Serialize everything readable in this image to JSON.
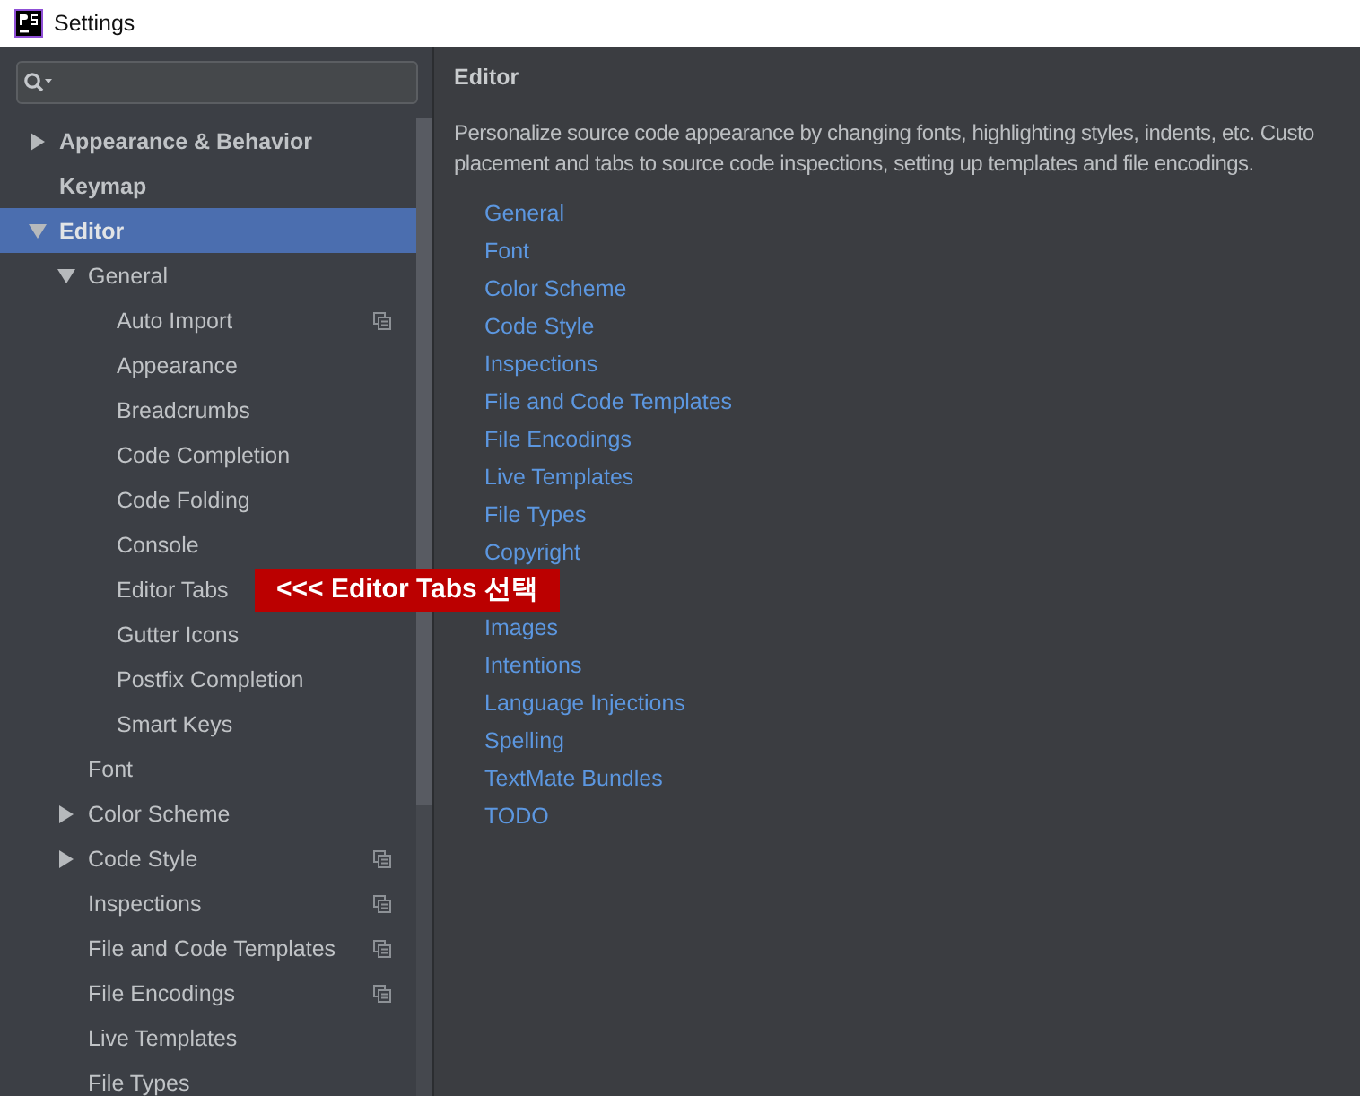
{
  "window": {
    "title": "Settings"
  },
  "tree": [
    {
      "label": "Appearance & Behavior",
      "selected": false,
      "expanded": false,
      "scoped": false
    },
    {
      "label": "Keymap",
      "selected": false,
      "scoped": false
    },
    {
      "label": "Editor",
      "selected": true,
      "expanded": true,
      "scoped": false,
      "children": [
        {
          "label": "General",
          "selected": false,
          "expanded": true,
          "scoped": false,
          "children": [
            {
              "label": "Auto Import",
              "selected": false,
              "scoped": true
            },
            {
              "label": "Appearance",
              "selected": false,
              "scoped": false
            },
            {
              "label": "Breadcrumbs",
              "selected": false,
              "scoped": false
            },
            {
              "label": "Code Completion",
              "selected": false,
              "scoped": false
            },
            {
              "label": "Code Folding",
              "selected": false,
              "scoped": false
            },
            {
              "label": "Console",
              "selected": false,
              "scoped": false
            },
            {
              "label": "Editor Tabs",
              "selected": false,
              "scoped": false
            },
            {
              "label": "Gutter Icons",
              "selected": false,
              "scoped": false
            },
            {
              "label": "Postfix Completion",
              "selected": false,
              "scoped": false
            },
            {
              "label": "Smart Keys",
              "selected": false,
              "scoped": false
            }
          ]
        },
        {
          "label": "Font",
          "selected": false,
          "scoped": false
        },
        {
          "label": "Color Scheme",
          "selected": false,
          "expanded": false,
          "scoped": false
        },
        {
          "label": "Code Style",
          "selected": false,
          "expanded": false,
          "scoped": true
        },
        {
          "label": "Inspections",
          "selected": false,
          "scoped": true
        },
        {
          "label": "File and Code Templates",
          "selected": false,
          "scoped": true
        },
        {
          "label": "File Encodings",
          "selected": false,
          "scoped": true
        },
        {
          "label": "Live Templates",
          "selected": false,
          "scoped": false
        },
        {
          "label": "File Types",
          "selected": false,
          "scoped": false
        }
      ]
    }
  ],
  "content": {
    "title": "Editor",
    "description_lines": [
      "Personalize source code appearance by changing fonts, highlighting styles, indents, etc. Custo",
      "placement and tabs to source code inspections, setting up templates and file encodings."
    ],
    "links": [
      "General",
      "Font",
      "Color Scheme",
      "Code Style",
      "Inspections",
      "File and Code Templates",
      "File Encodings",
      "Live Templates",
      "File Types",
      "Copyright"
    ],
    "more_links": [
      "Images",
      "Intentions",
      "Language Injections",
      "Spelling",
      "TextMate Bundles",
      "TODO"
    ]
  },
  "callout": {
    "text": "<<< Editor Tabs 선택"
  }
}
